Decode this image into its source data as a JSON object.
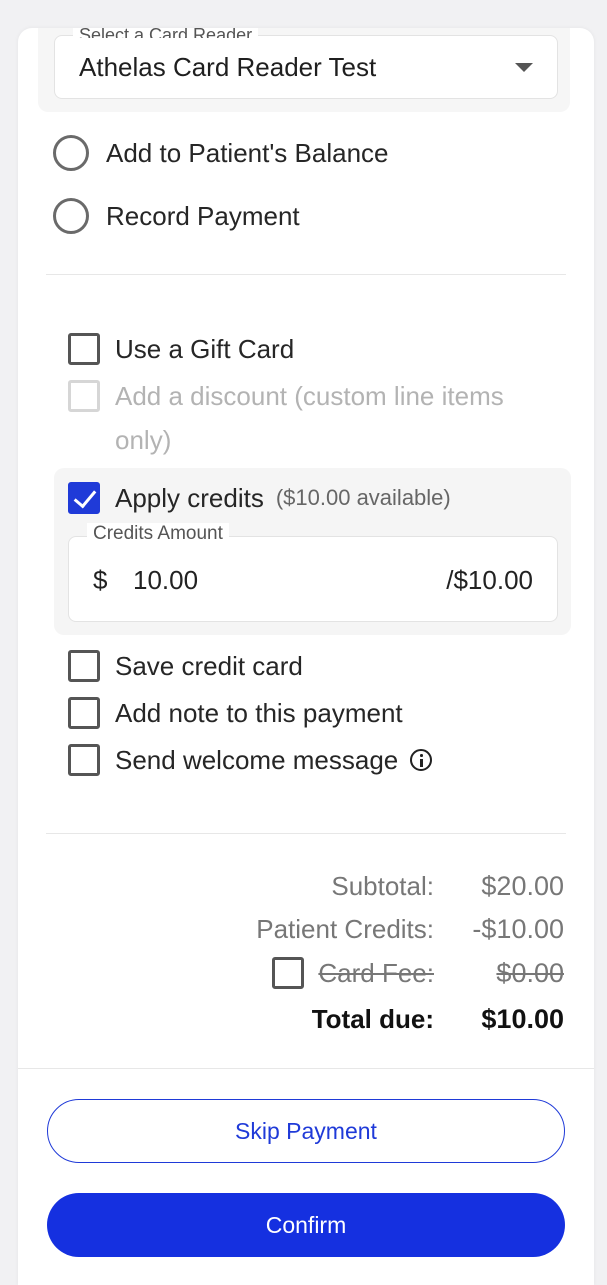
{
  "card_reader": {
    "legend": "Select a Card Reader",
    "selected": "Athelas Card Reader Test"
  },
  "payment_options": [
    {
      "label": "Add to Patient's Balance"
    },
    {
      "label": "Record Payment"
    }
  ],
  "options": {
    "gift_card": "Use a Gift Card",
    "discount": "Add a discount (custom line items only)",
    "apply_credits": "Apply credits",
    "credits_available": "($10.00 available)",
    "credits_amount_legend": "Credits Amount",
    "credits_currency": "$",
    "credits_value": "10.00",
    "credits_max": "/$10.00",
    "save_card": "Save credit card",
    "add_note": "Add note to this payment",
    "welcome_message": "Send welcome message"
  },
  "summary": {
    "subtotal_label": "Subtotal:",
    "subtotal_value": "$20.00",
    "credits_label": "Patient Credits:",
    "credits_value": "-$10.00",
    "fee_label": "Card Fee:",
    "fee_value": "$0.00",
    "total_label": "Total due:",
    "total_value": "$10.00"
  },
  "buttons": {
    "skip": "Skip Payment",
    "confirm": "Confirm"
  },
  "colors": {
    "accent": "#1f3ad8",
    "confirm_bg": "#1530e0"
  }
}
